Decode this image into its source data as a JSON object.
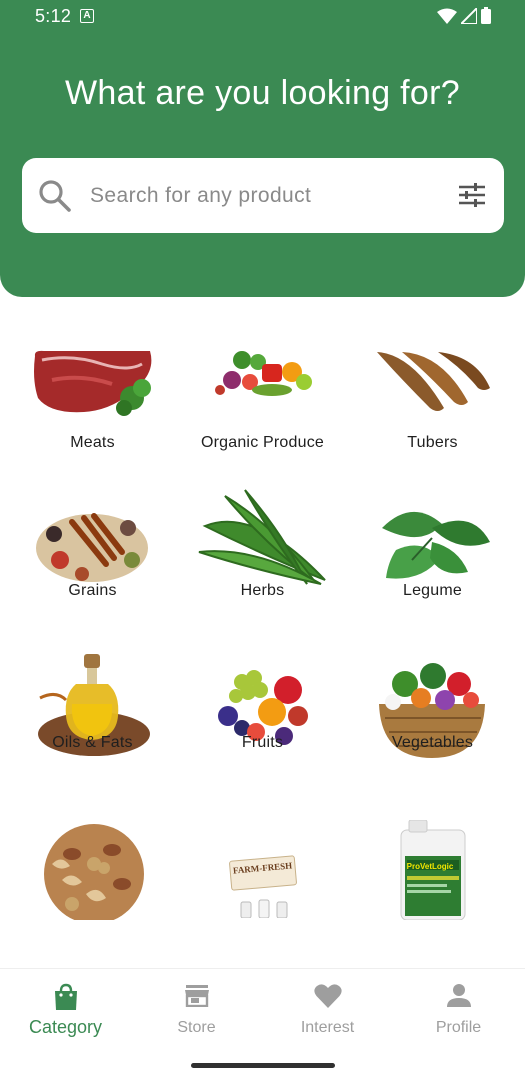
{
  "status_bar": {
    "time": "5:12",
    "notification_letter": "A"
  },
  "header": {
    "title": "What are you looking for?"
  },
  "search": {
    "placeholder": "Search for any product"
  },
  "categories": [
    {
      "label": "Meats",
      "icon": "meat-icon"
    },
    {
      "label": "Organic Produce",
      "icon": "organic-produce-icon"
    },
    {
      "label": "Tubers",
      "icon": "tubers-icon"
    },
    {
      "label": "Grains",
      "icon": "grains-icon"
    },
    {
      "label": "Herbs",
      "icon": "herbs-icon"
    },
    {
      "label": "Legume",
      "icon": "legume-icon"
    },
    {
      "label": "Oils & Fats",
      "icon": "oil-bottle-icon"
    },
    {
      "label": "Fruits",
      "icon": "fruits-icon"
    },
    {
      "label": "Vegetables",
      "icon": "vegetable-basket-icon"
    },
    {
      "label": "",
      "icon": "nuts-icon"
    },
    {
      "label": "",
      "icon": "farm-fresh-milk-icon"
    },
    {
      "label": "",
      "icon": "provet-jug-icon"
    }
  ],
  "image_text": {
    "farm_fresh": "FARM-FRESH",
    "provet": "ProVetLogic"
  },
  "bottom_nav": {
    "items": [
      {
        "label": "Category",
        "icon": "shopping-bag-icon",
        "active": true
      },
      {
        "label": "Store",
        "icon": "store-icon",
        "active": false
      },
      {
        "label": "Interest",
        "icon": "heart-icon",
        "active": false
      },
      {
        "label": "Profile",
        "icon": "person-icon",
        "active": false
      }
    ]
  },
  "colors": {
    "brand_green": "#3b8a53",
    "inactive_gray": "#9e9e9e"
  }
}
